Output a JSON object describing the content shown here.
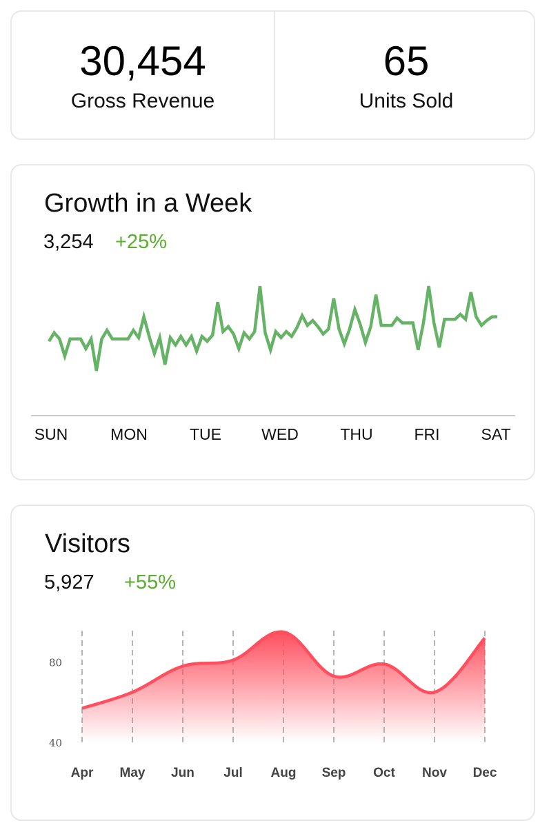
{
  "stats": {
    "gross_revenue": {
      "value": "30,454",
      "label": "Gross Revenue"
    },
    "units_sold": {
      "value": "65",
      "label": "Units Sold"
    }
  },
  "growth": {
    "title": "Growth in a Week",
    "value": "3,254",
    "change": "+25%",
    "color": "#66b266"
  },
  "visitors": {
    "title": "Visitors",
    "value": "5,927",
    "change": "+55%",
    "color": "#ff4f5e"
  },
  "chart_data": [
    {
      "type": "line",
      "title": "Growth in a Week",
      "categories": [
        "SUN",
        "MON",
        "TUE",
        "WED",
        "THU",
        "FRI",
        "SAT"
      ],
      "ylim": [
        0,
        100
      ],
      "grid": false,
      "values": [
        42,
        49,
        44,
        30,
        44,
        44,
        44,
        36,
        44,
        18,
        44,
        51,
        44,
        44,
        44,
        44,
        51,
        45,
        62,
        46,
        32,
        45,
        23,
        45,
        39,
        46,
        39,
        46,
        34,
        46,
        42,
        47,
        74,
        50,
        54,
        48,
        36,
        49,
        44,
        50,
        87,
        49,
        35,
        50,
        45,
        50,
        46,
        53,
        63,
        55,
        59,
        54,
        48,
        52,
        77,
        52,
        40,
        52,
        68,
        56,
        41,
        54,
        80,
        55,
        55,
        55,
        61,
        57,
        57,
        57,
        35,
        57,
        87,
        57,
        37,
        60,
        60,
        60,
        64,
        60,
        82,
        62,
        55,
        59,
        62,
        62
      ]
    },
    {
      "type": "area",
      "title": "Visitors",
      "categories": [
        "Apr",
        "May",
        "Jun",
        "Jul",
        "Aug",
        "Sep",
        "Oct",
        "Nov",
        "Dec"
      ],
      "values": [
        57,
        65,
        78,
        81,
        95,
        73,
        79,
        65,
        92
      ],
      "ylim": [
        40,
        95
      ],
      "yticks": [
        40,
        80
      ],
      "grid": "vertical-dashed"
    }
  ]
}
